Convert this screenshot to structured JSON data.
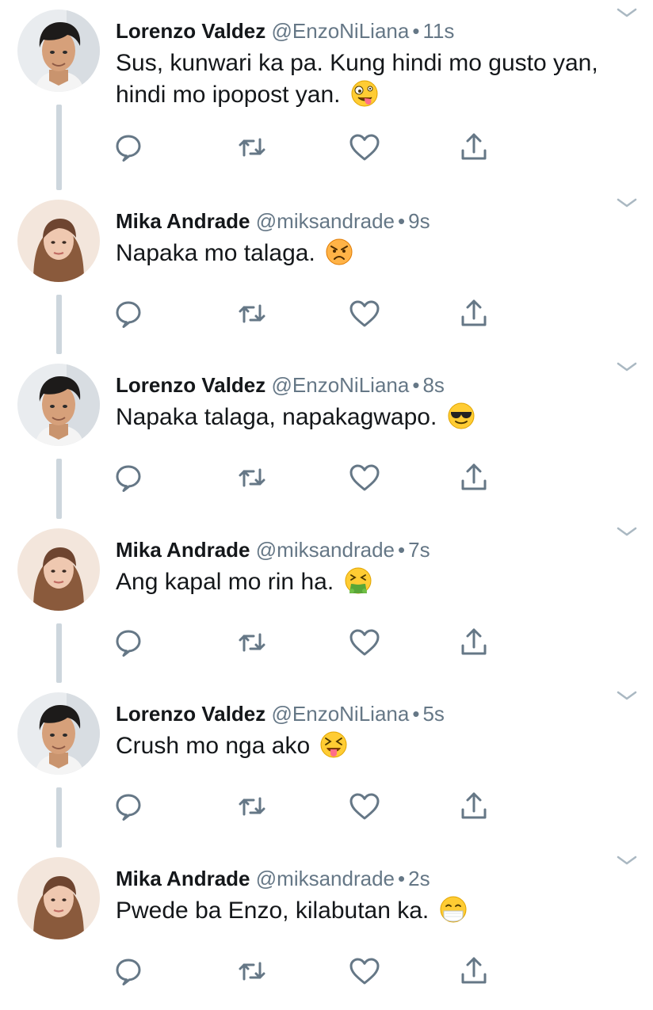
{
  "colors": {
    "text": "#14171a",
    "secondary": "#657786",
    "thread_line": "#cdd6dd",
    "icon": "#657786"
  },
  "tweets": [
    {
      "author": "lorenzo",
      "name": "Lorenzo Valdez",
      "handle": "@EnzoNiLiana",
      "separator": "•",
      "time": "11s",
      "text": "Sus, kunwari ka pa. Kung hindi mo gusto yan, hindi mo ipopost yan.",
      "emoji": "zany-face-emoji"
    },
    {
      "author": "mika",
      "name": "Mika Andrade",
      "handle": "@miksandrade",
      "separator": "•",
      "time": "9s",
      "text": "Napaka mo talaga.",
      "emoji": "angry-face-emoji"
    },
    {
      "author": "lorenzo",
      "name": "Lorenzo Valdez",
      "handle": "@EnzoNiLiana",
      "separator": "•",
      "time": "8s",
      "text": "Napaka talaga, napakagwapo.",
      "emoji": "sunglasses-face-emoji"
    },
    {
      "author": "mika",
      "name": "Mika Andrade",
      "handle": "@miksandrade",
      "separator": "•",
      "time": "7s",
      "text": "Ang kapal mo rin ha.",
      "emoji": "vomiting-face-emoji"
    },
    {
      "author": "lorenzo",
      "name": "Lorenzo Valdez",
      "handle": "@EnzoNiLiana",
      "separator": "•",
      "time": "5s",
      "text": "Crush mo nga ako",
      "emoji": "squinting-tongue-face-emoji"
    },
    {
      "author": "mika",
      "name": "Mika Andrade",
      "handle": "@miksandrade",
      "separator": "•",
      "time": "2s",
      "text": "Pwede ba Enzo, kilabutan ka.",
      "emoji": "mask-face-emoji"
    }
  ],
  "icons": {
    "reply": "reply-icon",
    "retweet": "retweet-icon",
    "like": "heart-icon",
    "share": "share-icon",
    "menu": "chevron-down-icon",
    "avatar_lorenzo": "avatar-lorenzo",
    "avatar_mika": "avatar-mika"
  }
}
